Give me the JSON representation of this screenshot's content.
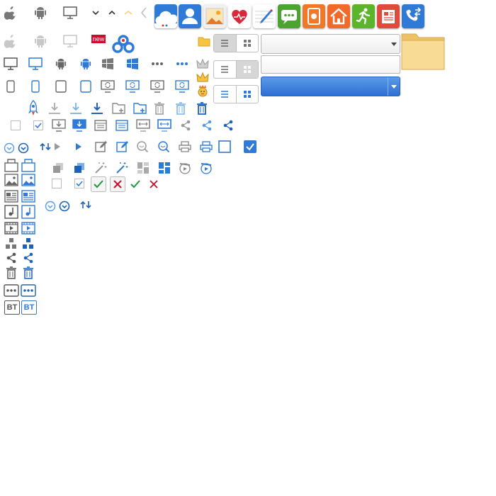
{
  "badge": {
    "new_label": "new"
  },
  "toolbar": {
    "bt_label": "BT"
  },
  "colors": {
    "grey": "#777777",
    "blue": "#2f7ad6",
    "green": "#1f9a3a",
    "red": "#c8102e",
    "folder": "#f5d488"
  },
  "app_tiles": [
    {
      "name": "cloud-app-icon",
      "bg": "#2f7ad6"
    },
    {
      "name": "contact-app-icon",
      "bg": "#2f7ad6"
    },
    {
      "name": "photo-app-icon",
      "bg": "#f0f0f0"
    },
    {
      "name": "health-app-icon",
      "bg": "#ffffff"
    },
    {
      "name": "notes-app-icon",
      "bg": "#ffffff"
    },
    {
      "name": "message-app-icon",
      "bg": "#4ca32f"
    },
    {
      "name": "recorder-app-icon",
      "bg": "#f07828"
    },
    {
      "name": "home-app-icon",
      "bg": "#f06a2a"
    },
    {
      "name": "fitness-app-icon",
      "bg": "#5ab52a"
    },
    {
      "name": "news-app-icon",
      "bg": "#e04a3a"
    },
    {
      "name": "phone-transfer-app-icon",
      "bg": "#2f7ad6"
    }
  ]
}
